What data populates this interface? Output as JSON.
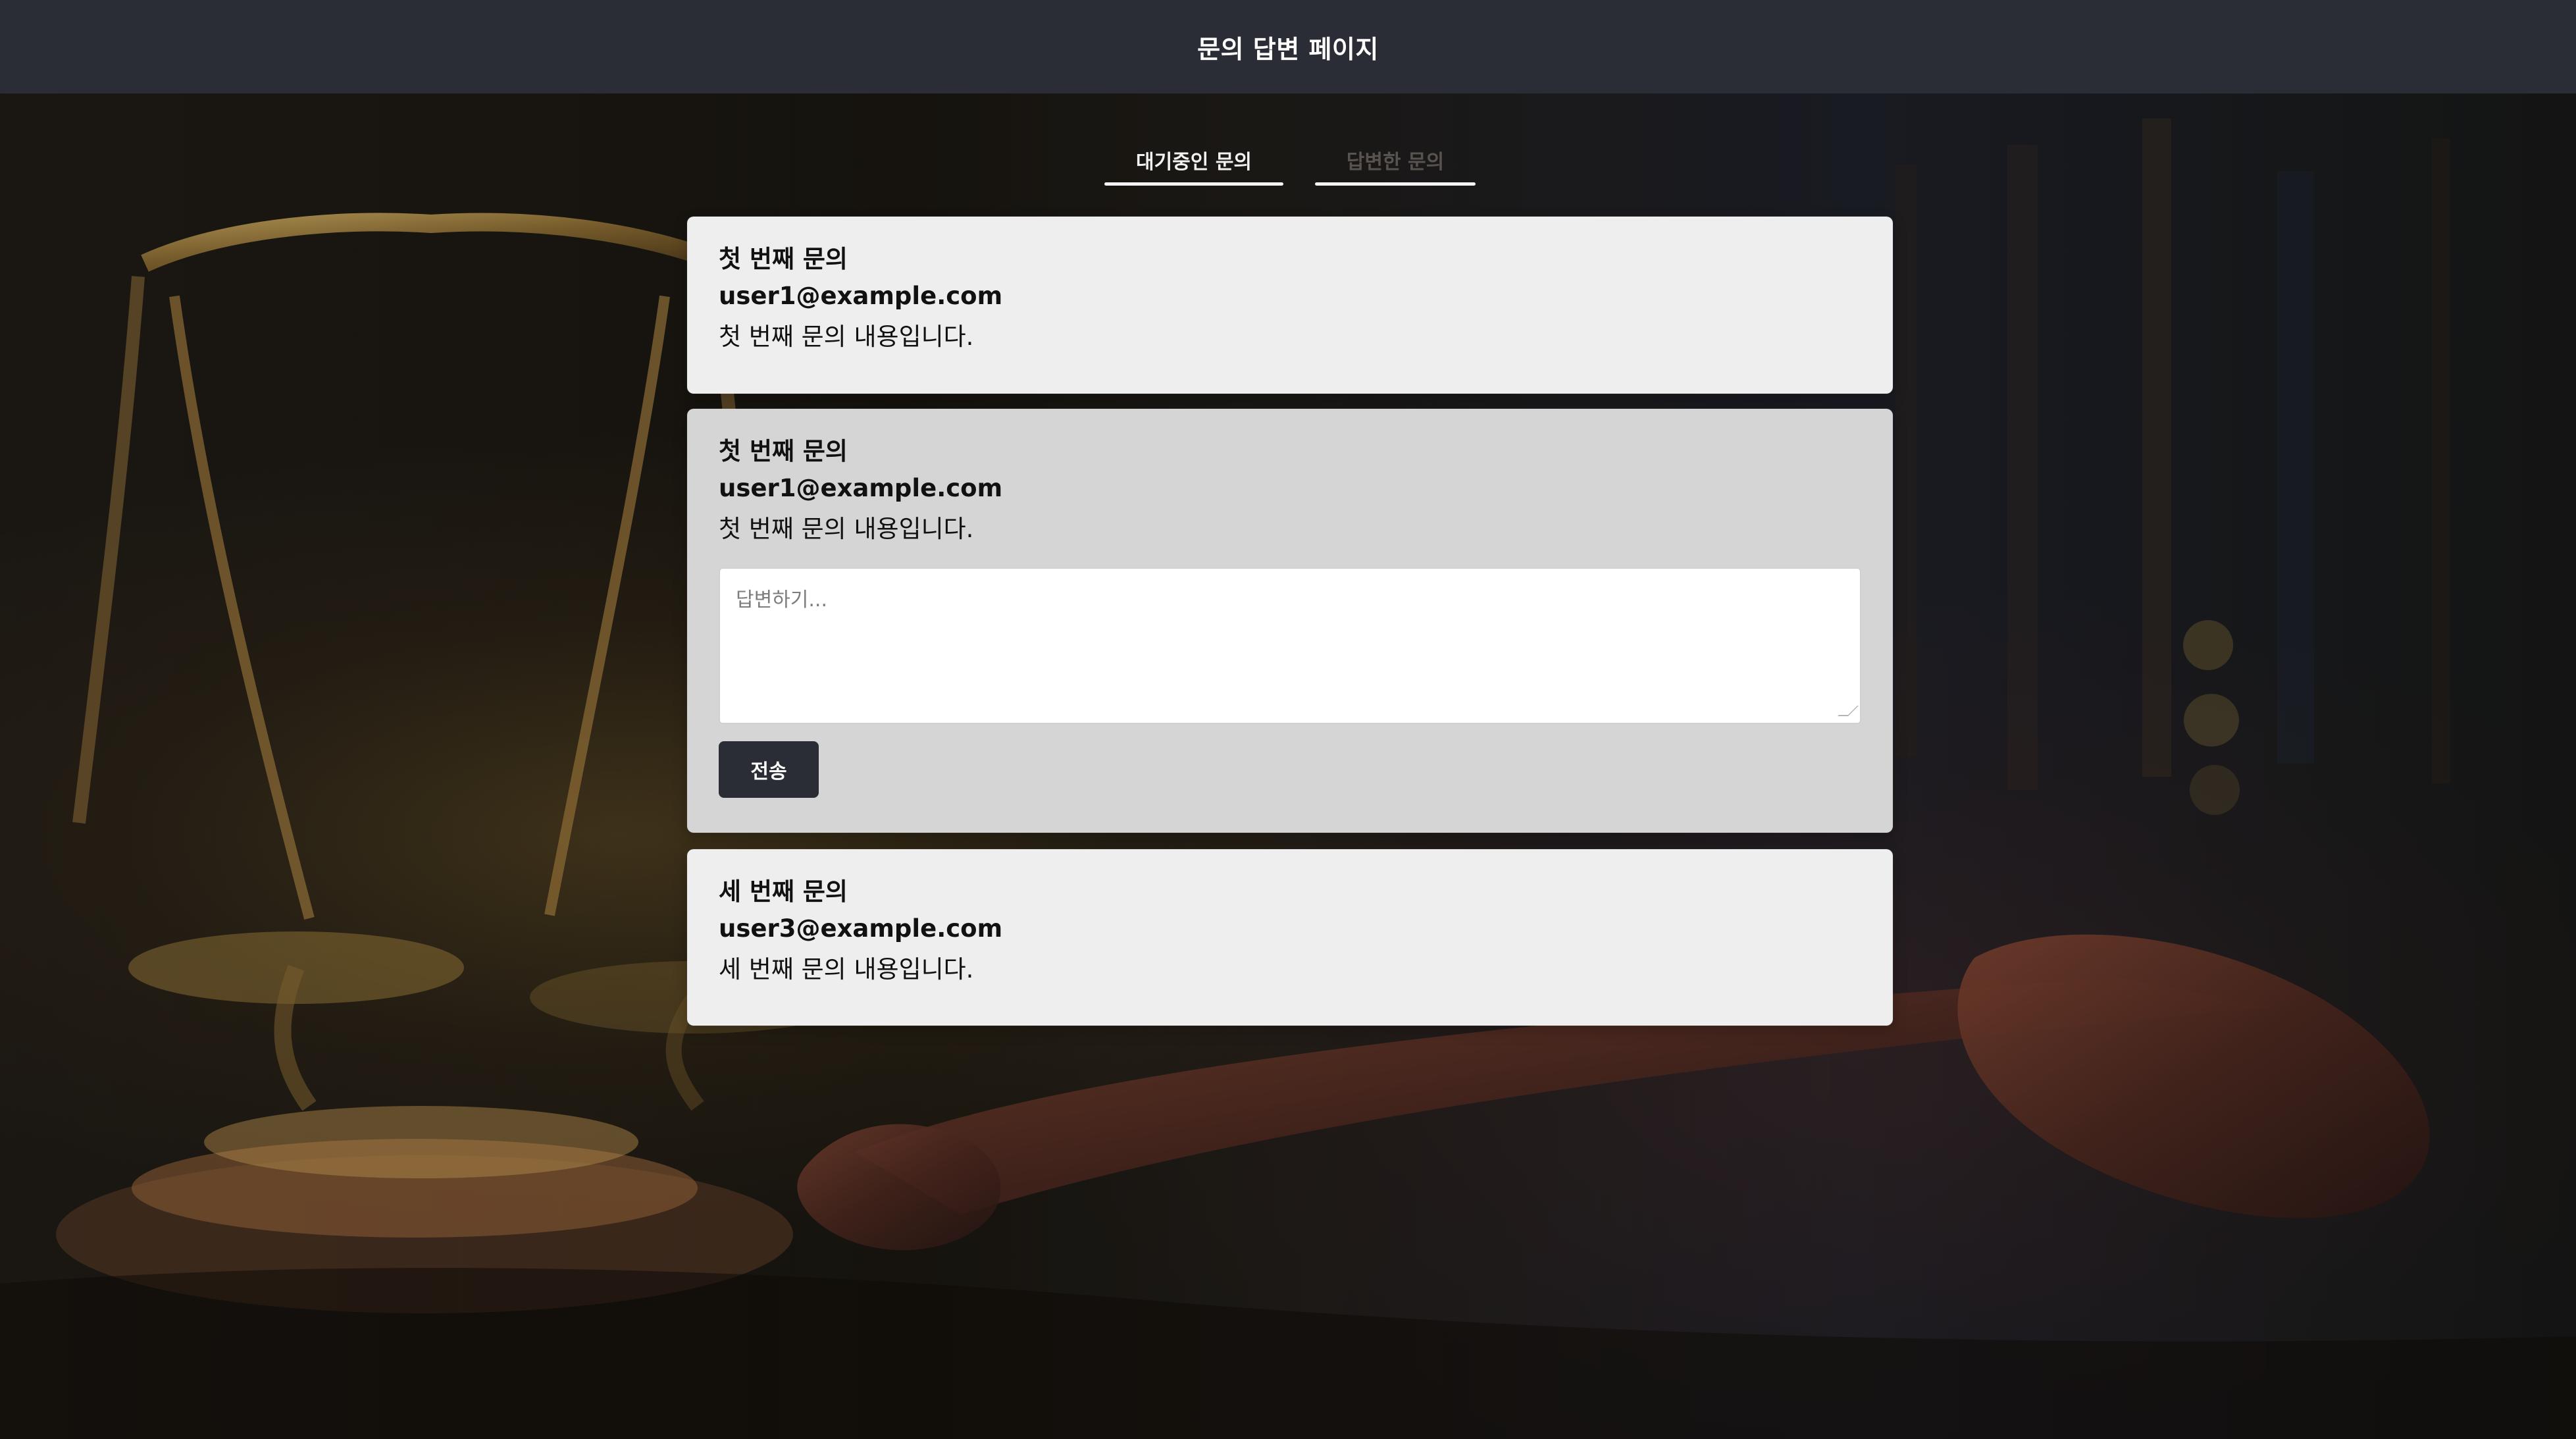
{
  "header": {
    "title": "문의 답변 페이지"
  },
  "tabs": [
    {
      "label": "대기중인 문의",
      "active": true
    },
    {
      "label": "답변한 문의",
      "active": false
    }
  ],
  "inquiries": [
    {
      "title": "첫 번째 문의",
      "email": "user1@example.com",
      "content": "첫 번째 문의 내용입니다."
    },
    {
      "title": "첫 번째 문의",
      "email": "user1@example.com",
      "content": "첫 번째 문의 내용입니다.",
      "reply_placeholder": "답변하기...",
      "submit_label": "전송"
    },
    {
      "title": "세 번째 문의",
      "email": "user3@example.com",
      "content": "세 번째 문의 내용입니다."
    }
  ]
}
